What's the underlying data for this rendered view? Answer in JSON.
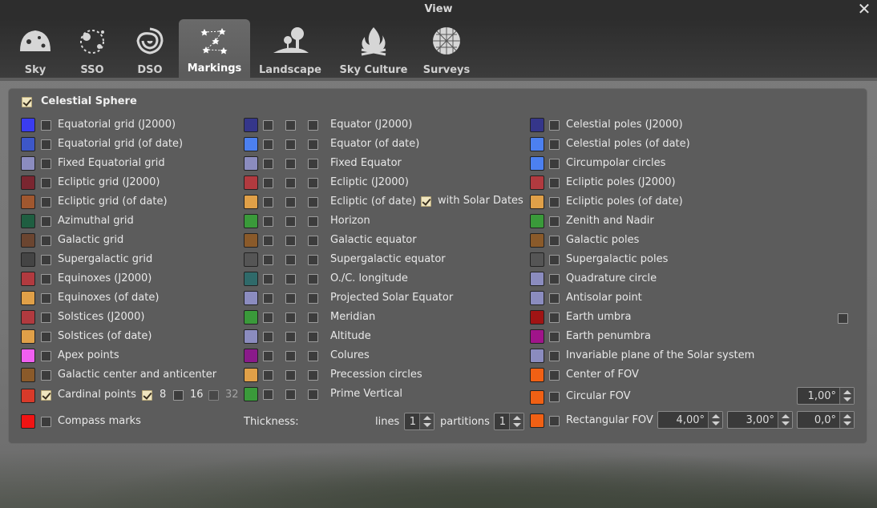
{
  "window": {
    "title": "View",
    "close_glyph": "✕"
  },
  "tabs": [
    {
      "label": "Sky",
      "icon": "sky-icon"
    },
    {
      "label": "SSO",
      "icon": "sso-icon"
    },
    {
      "label": "DSO",
      "icon": "dso-icon"
    },
    {
      "label": "Markings",
      "icon": "markings-icon",
      "active": true
    },
    {
      "label": "Landscape",
      "icon": "landscape-icon"
    },
    {
      "label": "Sky Culture",
      "icon": "sky-culture-icon"
    },
    {
      "label": "Surveys",
      "icon": "surveys-icon"
    }
  ],
  "section": {
    "label": "Celestial Sphere",
    "checked": true
  },
  "col1": [
    {
      "label": "Equatorial grid (J2000)",
      "color": "#3a3cf0"
    },
    {
      "label": "Equatorial grid (of date)",
      "color": "#3d57c8"
    },
    {
      "label": "Fixed Equatorial grid",
      "color": "#8b8cbf"
    },
    {
      "label": "Ecliptic grid (J2000)",
      "color": "#7a2630"
    },
    {
      "label": "Ecliptic grid (of date)",
      "color": "#a0572f"
    },
    {
      "label": "Azimuthal grid",
      "color": "#1f5e41"
    },
    {
      "label": "Galactic grid",
      "color": "#6b4530"
    },
    {
      "label": "Supergalactic grid",
      "color": "#444444"
    },
    {
      "label": "Equinoxes (J2000)",
      "color": "#b13a3f"
    },
    {
      "label": "Equinoxes (of date)",
      "color": "#e0a048"
    },
    {
      "label": "Solstices (J2000)",
      "color": "#b13a3f"
    },
    {
      "label": "Solstices (of date)",
      "color": "#e0a048"
    },
    {
      "label": "Apex points",
      "color": "#f05ff0"
    },
    {
      "label": "Galactic center and anticenter",
      "color": "#8a5a2a"
    }
  ],
  "cardinal": {
    "label": "Cardinal points",
    "color": "#d83a2a",
    "checked": true,
    "opt8": "8",
    "opt16": "16",
    "opt32": "32"
  },
  "compass": {
    "label": "Compass marks",
    "color": "#f01414"
  },
  "col2": [
    {
      "label": "Equator (J2000)",
      "color": "#35368a"
    },
    {
      "label": "Equator (of date)",
      "color": "#4c80f0"
    },
    {
      "label": "Fixed Equator",
      "color": "#8b8cbf"
    },
    {
      "label": "Ecliptic (J2000)",
      "color": "#b13a3f"
    },
    {
      "label": "Ecliptic (of date)",
      "color": "#e0a048"
    },
    {
      "label": "Horizon",
      "color": "#3a9a3a"
    },
    {
      "label": "Galactic equator",
      "color": "#8a5a2a"
    },
    {
      "label": "Supergalactic equator",
      "color": "#555555"
    },
    {
      "label": "O./C. longitude",
      "color": "#2f6a6a"
    },
    {
      "label": "Projected Solar Equator",
      "color": "#8b8cbf"
    },
    {
      "label": "Meridian",
      "color": "#3a9a3a"
    },
    {
      "label": "Altitude",
      "color": "#8b8cbf"
    },
    {
      "label": "Colures",
      "color": "#8a1a8a"
    },
    {
      "label": "Precession circles",
      "color": "#e0a048"
    },
    {
      "label": "Prime Vertical",
      "color": "#3a9a3a"
    }
  ],
  "solar_dates": {
    "label": "with Solar Dates",
    "checked": true
  },
  "thickness": {
    "label": "Thickness:",
    "lines_label": "lines",
    "lines_value": "1",
    "partitions_label": "partitions",
    "partitions_value": "1"
  },
  "col3": [
    {
      "label": "Celestial poles (J2000)",
      "color": "#35368a"
    },
    {
      "label": "Celestial poles (of date)",
      "color": "#4c80f0"
    },
    {
      "label": "Circumpolar circles",
      "color": "#4c80f0"
    },
    {
      "label": "Ecliptic poles (J2000)",
      "color": "#b13a3f"
    },
    {
      "label": "Ecliptic poles (of date)",
      "color": "#e0a048"
    },
    {
      "label": "Zenith and Nadir",
      "color": "#3a9a3a"
    },
    {
      "label": "Galactic poles",
      "color": "#8a5a2a"
    },
    {
      "label": "Supergalactic poles",
      "color": "#555555"
    },
    {
      "label": "Quadrature circle",
      "color": "#8b8cbf"
    },
    {
      "label": "Antisolar point",
      "color": "#8b8cbf"
    },
    {
      "label": "Earth umbra",
      "color": "#a01414"
    },
    {
      "label": "Earth penumbra",
      "color": "#a0148a"
    },
    {
      "label": "Invariable plane of the Solar system",
      "color": "#8b8cbf"
    },
    {
      "label": "Center of FOV",
      "color": "#f06014"
    }
  ],
  "circular_fov": {
    "label": "Circular FOV",
    "color": "#f06014",
    "value": "1,00°"
  },
  "rect_fov": {
    "label": "Rectangular FOV",
    "color": "#f06014",
    "w": "4,00°",
    "h": "3,00°",
    "rot": "0,0°"
  }
}
